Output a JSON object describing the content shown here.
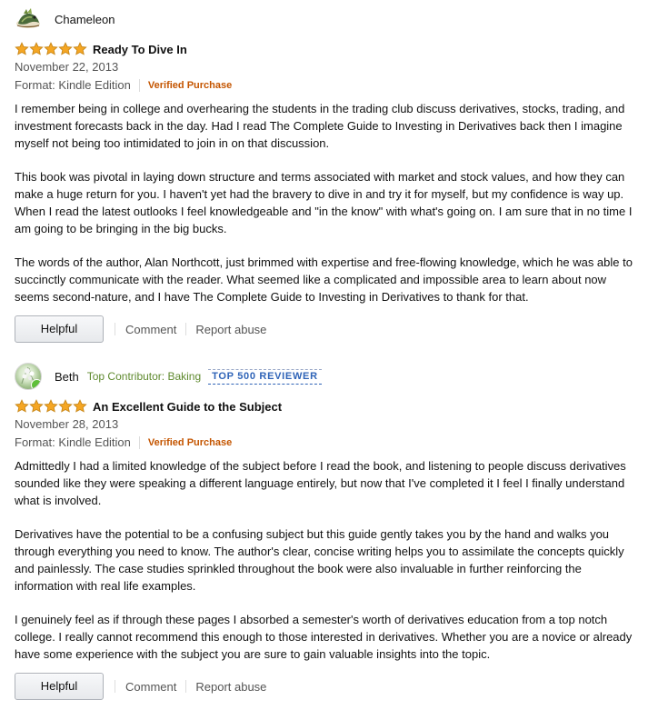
{
  "colors": {
    "star": "#f5a623",
    "star_outline": "#c88719",
    "verified": "#c45500",
    "contributor": "#5f8a2f",
    "badge": "#2e63b7"
  },
  "reviews": [
    {
      "reviewer": "Chameleon",
      "contributor_label": "",
      "badge": "",
      "avatar_icon": "chameleon-avatar-icon",
      "rating": 5,
      "title": "Ready To Dive In",
      "date": "November 22, 2013",
      "format": "Format: Kindle Edition",
      "verified": "Verified Purchase",
      "paragraphs": [
        "I remember being in college and overhearing the students in the trading club discuss derivatives, stocks, trading, and investment forecasts back in the day. Had I read The Complete Guide to Investing in Derivatives back then I imagine myself not being too intimidated to join in on that discussion.",
        "This book was pivotal in laying down structure and terms associated with market and stock values, and how they can make a huge return for you. I haven't yet had the bravery to dive in and try it for myself, but my confidence is way up. When I read the latest outlooks I feel knowledgeable and \"in the know\" with what's going on. I am sure that in no time I am going to be bringing in the big bucks.",
        "The words of the author, Alan Northcott, just brimmed with expertise and free-flowing knowledge, which he was able to succinctly communicate with the reader. What seemed like a complicated and impossible area to learn about now seems second-nature, and I have The Complete Guide to Investing in Derivatives to thank for that."
      ],
      "helpful_label": "Helpful",
      "comment_label": "Comment",
      "report_label": "Report abuse"
    },
    {
      "reviewer": "Beth",
      "contributor_label": "Top Contributor: Baking",
      "badge": "TOP 500 REVIEWER",
      "avatar_icon": "flower-avatar-icon",
      "rating": 5,
      "title": "An Excellent Guide to the Subject",
      "date": "November 28, 2013",
      "format": "Format: Kindle Edition",
      "verified": "Verified Purchase",
      "paragraphs": [
        "Admittedly I had a limited knowledge of the subject before I read the book, and listening to people discuss derivatives sounded like they were speaking a different language entirely, but now that I've completed it I feel I finally understand what is involved.",
        "Derivatives have the potential to be a confusing subject but this guide gently takes you by the hand and walks you through everything you need to know. The author's clear, concise writing helps you to assimilate the concepts quickly and painlessly. The case studies sprinkled throughout the book were also invaluable in further reinforcing the information with real life examples.",
        "I genuinely feel as if through these pages I absorbed a semester's worth of derivatives education from a top notch college. I really cannot recommend this enough to those interested in derivatives. Whether you are a novice or already have some experience with the subject you are sure to gain valuable insights into the topic."
      ],
      "helpful_label": "Helpful",
      "comment_label": "Comment",
      "report_label": "Report abuse"
    }
  ]
}
